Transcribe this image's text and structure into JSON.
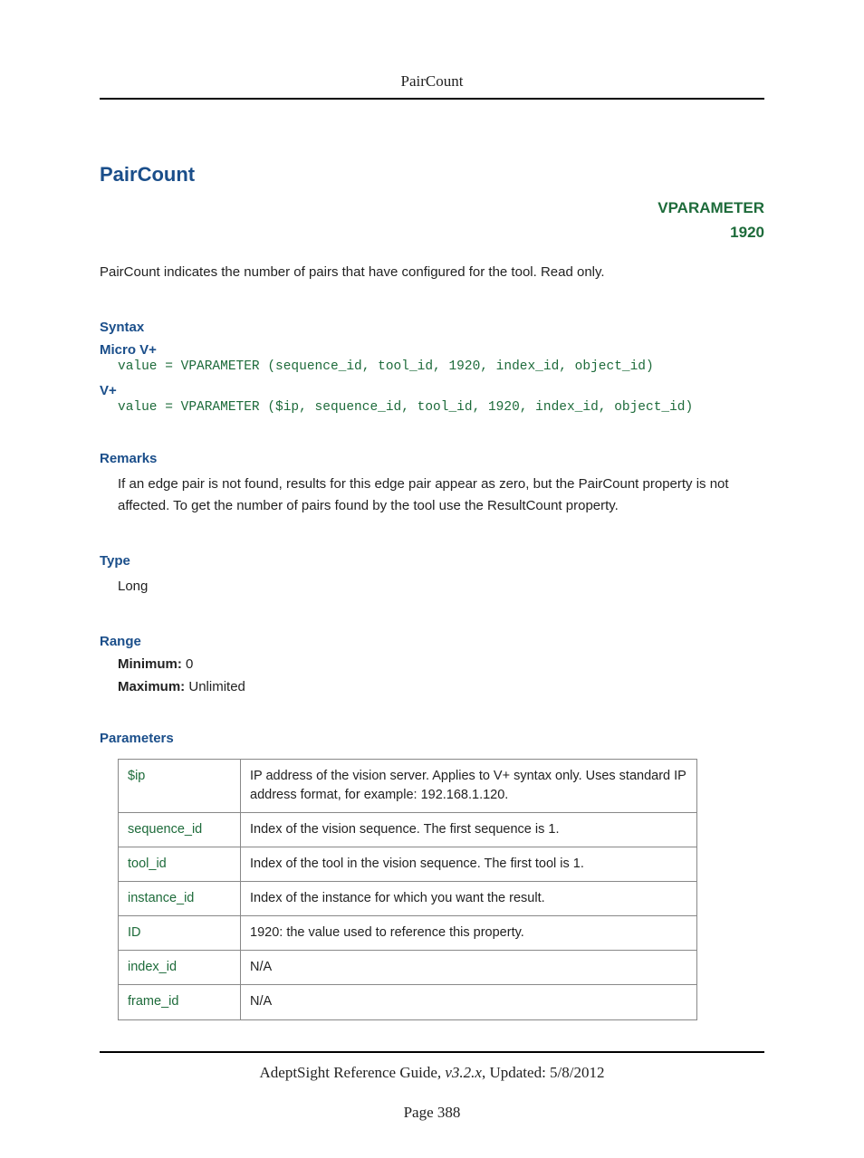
{
  "header": {
    "title": "PairCount"
  },
  "title": "PairCount",
  "vparam": {
    "label": "VPARAMETER",
    "id": "1920"
  },
  "description": "PairCount indicates the number of pairs that have configured for the tool. Read only.",
  "syntax": {
    "heading": "Syntax",
    "microv": {
      "label": "Micro V+",
      "code": "value = VPARAMETER (sequence_id, tool_id, 1920, index_id, object_id)"
    },
    "vplus": {
      "label": "V+",
      "code": "value = VPARAMETER ($ip, sequence_id, tool_id, 1920, index_id, object_id)"
    }
  },
  "remarks": {
    "heading": "Remarks",
    "text": "If an edge pair is not found, results for this edge pair appear as zero, but the PairCount property is not affected. To get the number of pairs found by the tool use the ResultCount property."
  },
  "type": {
    "heading": "Type",
    "value": "Long"
  },
  "range": {
    "heading": "Range",
    "min_label": "Minimum:",
    "min_value": "0",
    "max_label": "Maximum:",
    "max_value": "Unlimited"
  },
  "parameters": {
    "heading": "Parameters",
    "rows": [
      {
        "name": "$ip",
        "desc": "IP address of the vision server. Applies to V+ syntax only. Uses standard IP address format, for example: 192.168.1.120."
      },
      {
        "name": "sequence_id",
        "desc": "Index of the vision sequence. The first sequence is 1."
      },
      {
        "name": "tool_id",
        "desc": "Index of the tool in the vision sequence. The first tool is 1."
      },
      {
        "name": "instance_id",
        "desc": "Index of the instance for which you want the result."
      },
      {
        "name": "ID",
        "desc": "1920: the value used to reference this property."
      },
      {
        "name": "index_id",
        "desc": "N/A"
      },
      {
        "name": "frame_id",
        "desc": "N/A"
      }
    ]
  },
  "footer": {
    "guide": "AdeptSight Reference Guide",
    "version": ", v3.2.x",
    "updated": ", Updated: 5/8/2012",
    "page": "Page 388"
  }
}
